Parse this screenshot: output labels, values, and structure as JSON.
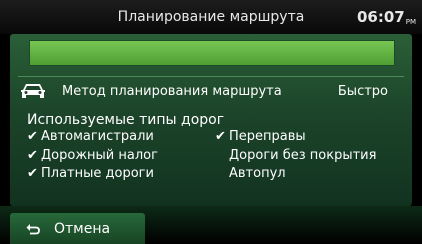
{
  "header": {
    "title": "Планирование маршрута",
    "clock": "06:07",
    "clock_suffix": "PM"
  },
  "progress": {
    "fraction": 1.0
  },
  "method": {
    "label": "Метод планирования маршрута",
    "value": "Быстро",
    "icon": "car-icon"
  },
  "roads": {
    "title": "Используемые типы дорог",
    "items": [
      {
        "label": "Автомагистрали",
        "checked": true
      },
      {
        "label": "Переправы",
        "checked": true
      },
      {
        "label": "Дорожный налог",
        "checked": true
      },
      {
        "label": "Дороги без покрытия",
        "checked": false
      },
      {
        "label": "Платные дороги",
        "checked": true
      },
      {
        "label": "Автопул",
        "checked": false
      }
    ]
  },
  "footer": {
    "cancel_label": "Отмена",
    "cancel_icon": "back-arrow-icon"
  },
  "colors": {
    "panel": "#1c452a",
    "progress": "#66b848",
    "button": "#1f5a30"
  }
}
